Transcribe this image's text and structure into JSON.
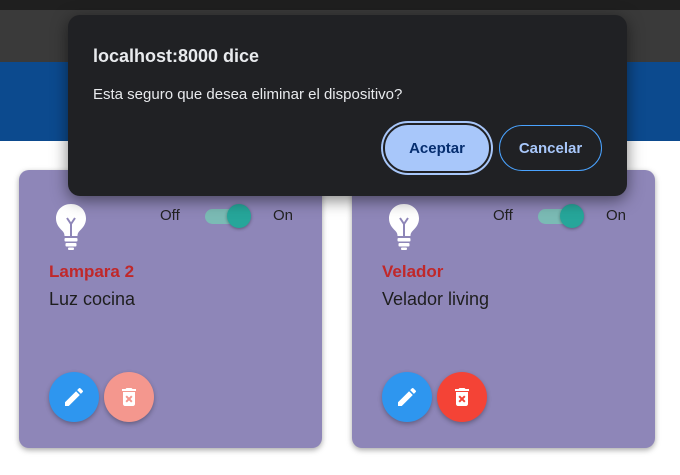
{
  "dialog": {
    "title": "localhost:8000 dice",
    "message": "Esta seguro que desea eliminar el dispositivo?",
    "ok_label": "Aceptar",
    "cancel_label": "Cancelar"
  },
  "devices": [
    {
      "name": "Lampara 2",
      "description": "Luz cocina",
      "off_label": "Off",
      "on_label": "On",
      "state": "on",
      "delete_button_color": "#f4978e"
    },
    {
      "name": "Velador",
      "description": "Velador living",
      "off_label": "Off",
      "on_label": "On",
      "state": "on",
      "delete_button_color": "#f44336"
    }
  ],
  "icons": [
    "lightbulb-icon",
    "pencil-icon",
    "trash-icon"
  ],
  "colors": {
    "header": "#0c4a8e",
    "card": "#8e86b8",
    "device_name": "#c0282a",
    "toggle_on": "#26a69a",
    "edit_button": "#2e96ef",
    "dialog_bg": "#202124",
    "dialog_accent": "#a8c7fa"
  }
}
